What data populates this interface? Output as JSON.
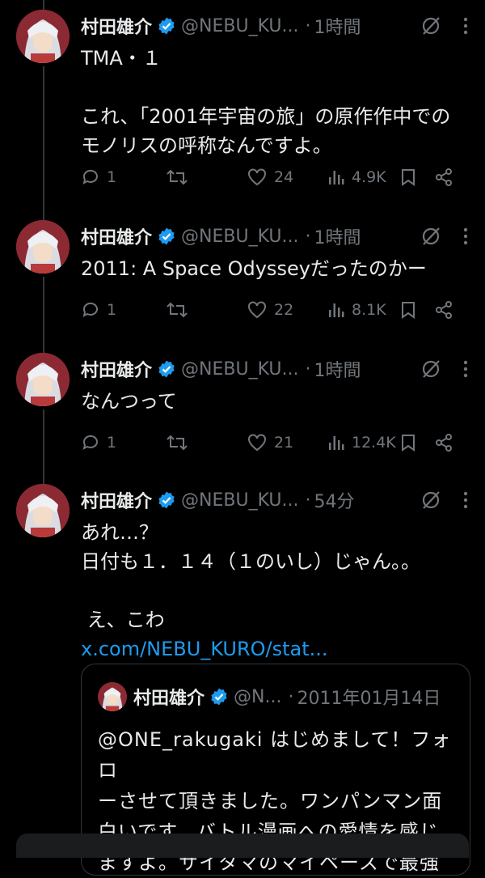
{
  "tweets": [
    {
      "name": "村田雄介",
      "handle": "@NEBU_KU...",
      "time": "1時間",
      "text": "TMA・１\n\nこれ、「2001年宇宙の旅」の原作作中での\nモノリスの呼称なんですよ。",
      "replies": "1",
      "retweets": "",
      "likes": "24",
      "views": "4.9K"
    },
    {
      "name": "村田雄介",
      "handle": "@NEBU_KU...",
      "time": "1時間",
      "text": "2011: A Space Odysseyだったのかー",
      "replies": "1",
      "retweets": "",
      "likes": "22",
      "views": "8.1K"
    },
    {
      "name": "村田雄介",
      "handle": "@NEBU_KU...",
      "time": "1時間",
      "text": "なんつって",
      "replies": "1",
      "retweets": "",
      "likes": "21",
      "views": "12.4K"
    },
    {
      "name": "村田雄介",
      "handle": "@NEBU_KU...",
      "time": "54分",
      "text": "あれ…？\n日付も１．１４（１のいし）じゃん。。\n\n え、こわ",
      "link": "x.com/NEBU_KURO/stat..."
    }
  ],
  "quote": {
    "name": "村田雄介",
    "handle": "@N...",
    "time": "2011年01月14日",
    "text": "@ONE_rakugaki はじめまして！フォロ\nーさせて頂きました。ワンパンマン面\n白いです。バトル漫画への愛情を感じ\nますよ。サイタマのマイペースで最強"
  },
  "icons": {
    "verified": "verified-badge-icon",
    "mute": "muted-slash-icon",
    "more": "more-vertical-icon",
    "reply": "reply-bubble-icon",
    "retweet": "retweet-icon",
    "like": "heart-icon",
    "views": "bar-chart-icon",
    "bookmark": "bookmark-icon",
    "share": "share-icon"
  },
  "colors": {
    "background": "#000000",
    "text": "#e7e9ea",
    "muted": "#71767b",
    "link": "#1d9bf0",
    "verified": "#1d9bf0"
  }
}
